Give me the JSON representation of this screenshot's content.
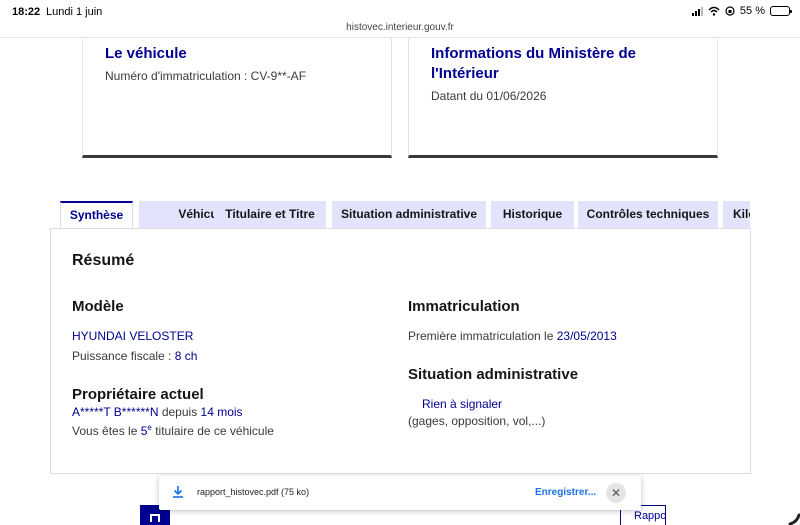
{
  "status": {
    "time": "18:22",
    "date": "Lundi 1 juin",
    "url": "histovec.interieur.gouv.fr",
    "battery": "55 %",
    "battery_level": 0.55
  },
  "cards": {
    "vehicle": {
      "title": "Le véhicule",
      "plate_text": "Numéro d'immatriculation : CV-9**-AF"
    },
    "ministry": {
      "title": "Informations du Ministère de l'Intérieur",
      "date_text": "Datant du 01/06/2026"
    }
  },
  "tabs": [
    {
      "label": "Synthèse",
      "active": true
    },
    {
      "label": "Véhicule",
      "active": false
    },
    {
      "label": "Titulaire et Titre",
      "active": false
    },
    {
      "label": "Situation administrative",
      "active": false
    },
    {
      "label": "Historique",
      "active": false
    },
    {
      "label": "Contrôles techniques",
      "active": false
    },
    {
      "label": "Kilométrage",
      "active": false
    }
  ],
  "summary": {
    "title": "Résumé",
    "model": {
      "heading": "Modèle",
      "name": "HYUNDAI VELOSTER",
      "power_label": "Puissance fiscale : ",
      "power_value": "8 ch"
    },
    "owner": {
      "heading": "Propriétaire actuel",
      "name": "A*****T B******N",
      "since_label": " depuis ",
      "since_value": "14 mois",
      "rank_prefix": "Vous êtes le ",
      "rank_number": "5",
      "rank_sup": "e",
      "rank_suffix": " titulaire de ce véhicule"
    },
    "registration": {
      "heading": "Immatriculation",
      "first_label": "Première immatriculation le ",
      "first_date": "23/05/2013"
    },
    "admin": {
      "heading": "Situation administrative",
      "status": "Rien à signaler",
      "details": "(gages, opposition, vol,...)"
    }
  },
  "download": {
    "filename": "rapport_histovec.pdf (75 ko)",
    "save_label": "Enregistrer...",
    "close_symbol": "✕"
  },
  "buttons": {
    "report_label": "Rapport"
  },
  "colors": {
    "brand_blue": "#000091",
    "tab_inactive": "#e3e3fd",
    "link_blue": "#1a73e8"
  }
}
